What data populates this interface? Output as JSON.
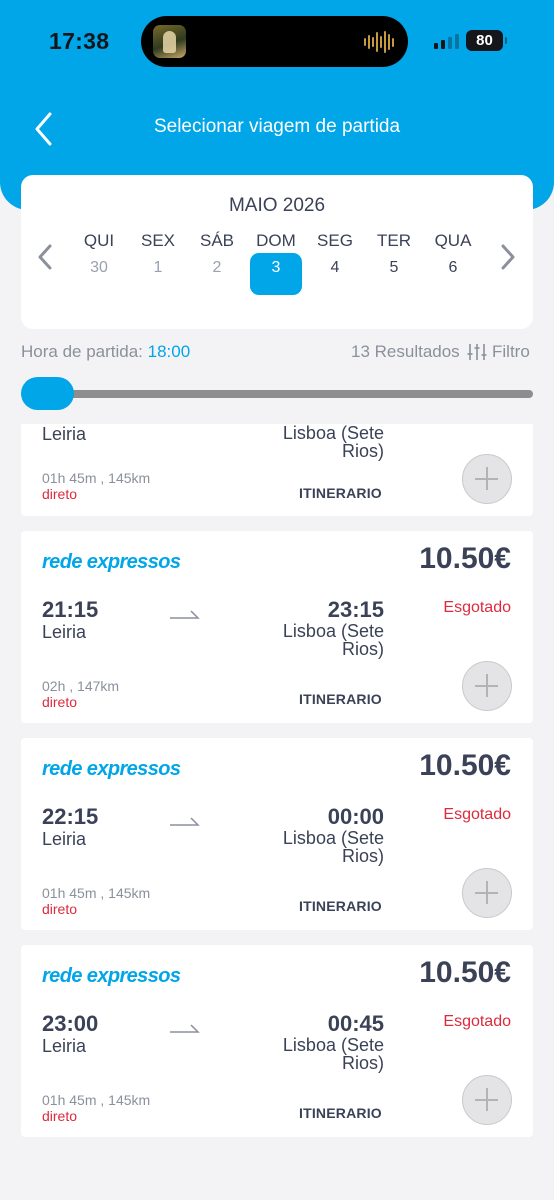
{
  "status_bar": {
    "time": "17:38",
    "battery": "80"
  },
  "header": {
    "title": "Selecionar viagem de partida",
    "back_icon": "chevron-left-icon"
  },
  "calendar": {
    "month": "MAIO 2026",
    "days": [
      {
        "name": "QUI",
        "num": "30",
        "state": "past"
      },
      {
        "name": "SEX",
        "num": "1",
        "state": "past"
      },
      {
        "name": "SÁB",
        "num": "2",
        "state": "past"
      },
      {
        "name": "DOM",
        "num": "3",
        "state": "selected"
      },
      {
        "name": "SEG",
        "num": "4",
        "state": "future"
      },
      {
        "name": "TER",
        "num": "5",
        "state": "future"
      },
      {
        "name": "QUA",
        "num": "6",
        "state": "future"
      }
    ]
  },
  "filters": {
    "departure_label": "Hora de partida:",
    "departure_value": "18:00",
    "results": "13 Resultados",
    "filter_label": "Filtro",
    "slider_level": 0
  },
  "trips": [
    {
      "brand": "",
      "price": "",
      "dep_time": "",
      "dep_city": "Leiria",
      "arr_time": "",
      "arr_city": "Lisboa (Sete Rios)",
      "status": "",
      "duration": "01h 45m , 145km",
      "direct": "direto",
      "itinerary": "ITINERARIO"
    },
    {
      "brand": "rede expressos",
      "price": "10.50€",
      "dep_time": "21:15",
      "dep_city": "Leiria",
      "arr_time": "23:15",
      "arr_city": "Lisboa (Sete Rios)",
      "status": "Esgotado",
      "duration": "02h , 147km",
      "direct": "direto",
      "itinerary": "ITINERARIO"
    },
    {
      "brand": "rede expressos",
      "price": "10.50€",
      "dep_time": "22:15",
      "dep_city": "Leiria",
      "arr_time": "00:00",
      "arr_city": "Lisboa (Sete Rios)",
      "status": "Esgotado",
      "duration": "01h 45m , 145km",
      "direct": "direto",
      "itinerary": "ITINERARIO"
    },
    {
      "brand": "rede expressos",
      "price": "10.50€",
      "dep_time": "23:00",
      "dep_city": "Leiria",
      "arr_time": "00:45",
      "arr_city": "Lisboa (Sete Rios)",
      "status": "Esgotado",
      "duration": "01h 45m , 145km",
      "direct": "direto",
      "itinerary": "ITINERARIO"
    }
  ],
  "colors": {
    "accent": "#00a6e8",
    "sold_out": "#dd2a3d",
    "text": "#3b4257"
  }
}
